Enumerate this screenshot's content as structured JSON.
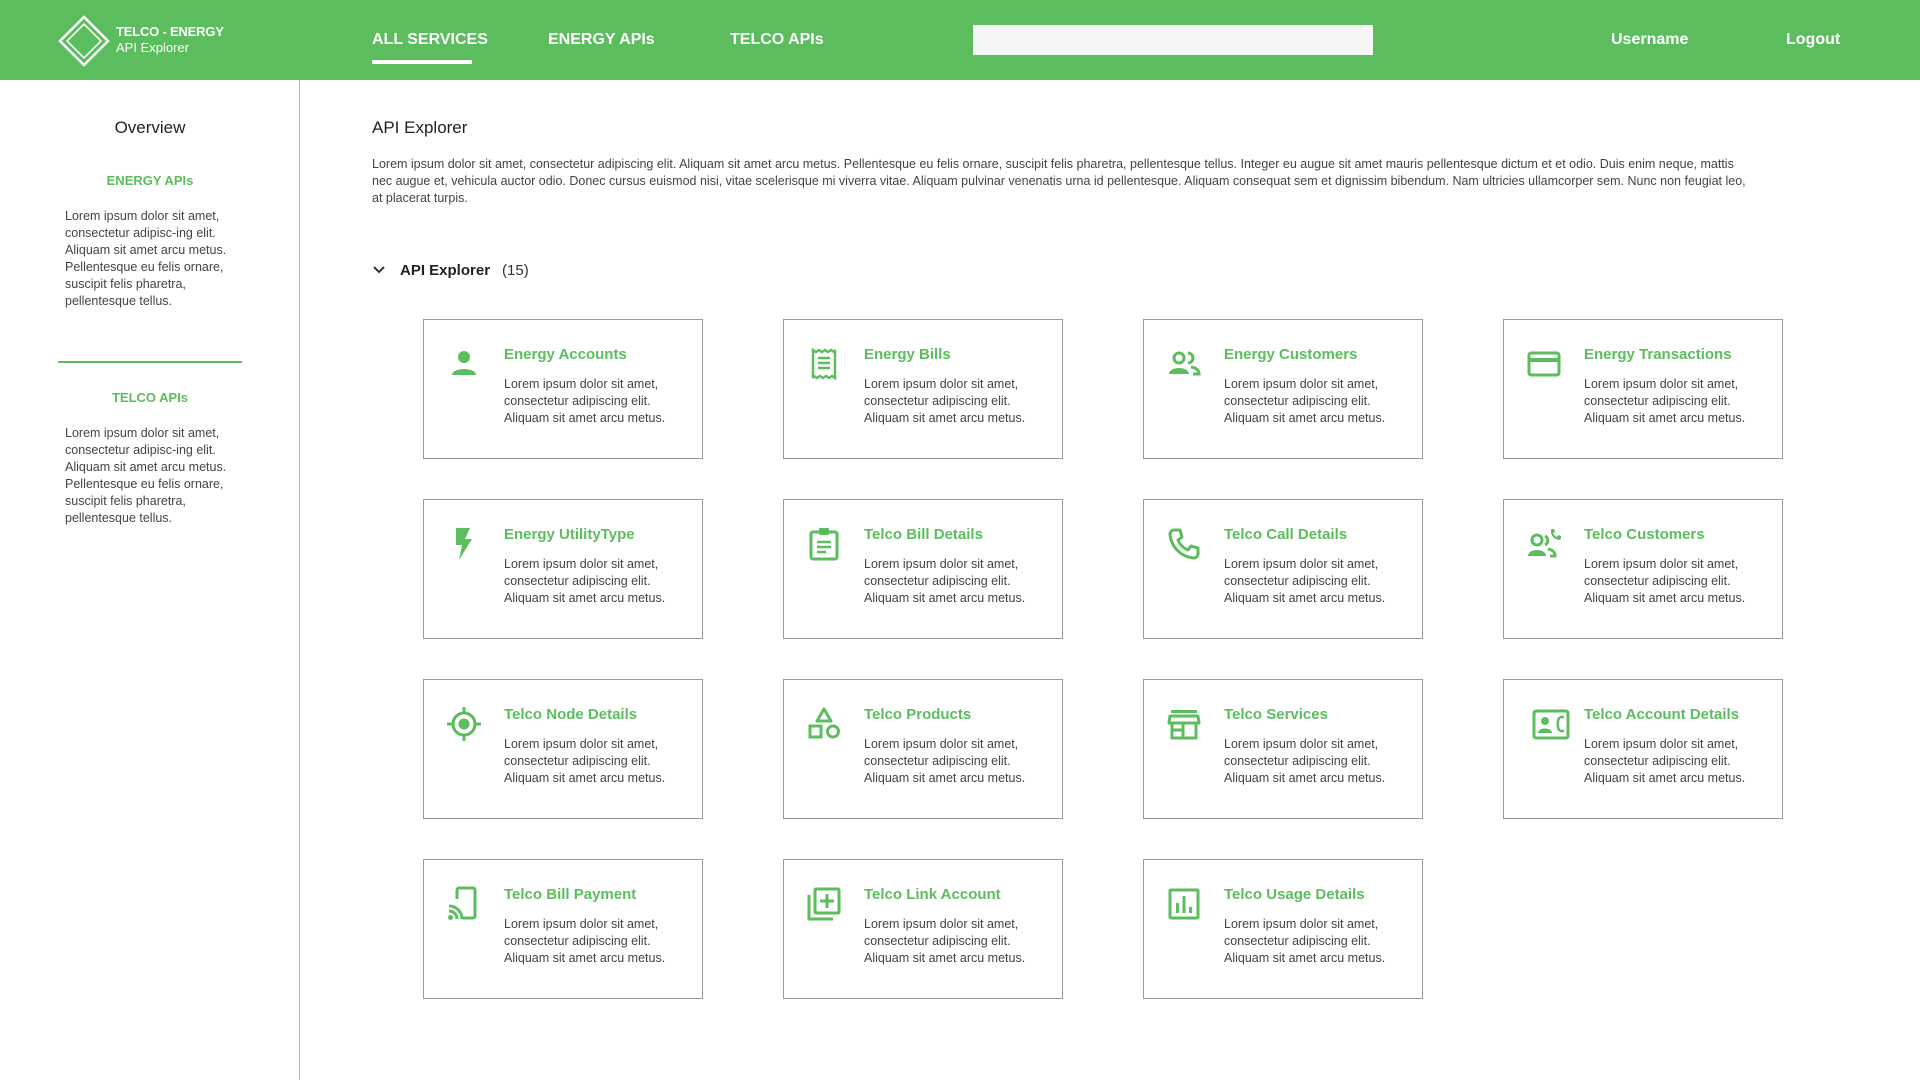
{
  "brand": {
    "line1": "TELCO - ENERGY",
    "line2": "API Explorer",
    "color": "#5cbd5f"
  },
  "nav": {
    "items": [
      {
        "label": "ALL SERVICES",
        "active": true
      },
      {
        "label": "ENERGY APIs",
        "active": false
      },
      {
        "label": "TELCO APIs",
        "active": false
      }
    ],
    "search": {
      "value": "",
      "placeholder": ""
    },
    "username": "Username",
    "logout": "Logout"
  },
  "sidebar": {
    "title": "Overview",
    "sections": [
      {
        "heading": "ENERGY APIs",
        "text": "Lorem ipsum dolor sit amet, consectetur adipisc-ing elit. Aliquam sit amet arcu metus. Pellentesque eu felis ornare, suscipit felis pharetra, pellentesque tellus."
      },
      {
        "heading": "TELCO APIs",
        "text": "Lorem ipsum dolor sit amet, consectetur adipisc-ing elit. Aliquam sit amet arcu metus. Pellentesque eu felis ornare, suscipit felis pharetra, pellentesque tellus."
      }
    ]
  },
  "main": {
    "title": "API Explorer",
    "description": "Lorem ipsum dolor sit amet, consectetur adipiscing elit. Aliquam sit amet arcu metus. Pellentesque eu felis ornare, suscipit felis pharetra, pellentesque tellus. Integer eu augue sit amet mauris pellentesque dictum et et odio. Duis enim neque, mattis nec augue et, vehicula auctor odio. Donec cursus euismod nisi, vitae scelerisque mi viverra vitae. Aliquam pulvinar venenatis urna id pellentesque. Aliquam consequat sem et dignissim bibendum. Nam ultricies ullamcorper sem. Nunc non feugiat leo, at placerat turpis.",
    "section": {
      "title": "API Explorer",
      "count": "(15)",
      "expanded": true
    },
    "cards": [
      {
        "title": "Energy Accounts",
        "icon": "person-icon",
        "description": "Lorem ipsum dolor sit amet, consectetur adipiscing elit. Aliquam sit amet arcu metus."
      },
      {
        "title": "Energy Bills",
        "icon": "receipt-icon",
        "description": "Lorem ipsum dolor sit amet, consectetur adipiscing elit. Aliquam sit amet arcu metus."
      },
      {
        "title": "Energy Customers",
        "icon": "people-icon",
        "description": "Lorem ipsum dolor sit amet, consectetur adipiscing elit. Aliquam sit amet arcu metus."
      },
      {
        "title": "Energy Transactions",
        "icon": "credit-card-icon",
        "description": "Lorem ipsum dolor sit amet, consectetur adipiscing elit. Aliquam sit amet arcu metus."
      },
      {
        "title": "Energy UtilityType",
        "icon": "bolt-icon",
        "description": "Lorem ipsum dolor sit amet, consectetur adipiscing elit. Aliquam sit amet arcu metus."
      },
      {
        "title": "Telco Bill Details",
        "icon": "clipboard-icon",
        "description": "Lorem ipsum dolor sit amet, consectetur adipiscing elit. Aliquam sit amet arcu metus."
      },
      {
        "title": "Telco Call Details",
        "icon": "phone-icon",
        "description": "Lorem ipsum dolor sit amet, consectetur adipiscing elit. Aliquam sit amet arcu metus."
      },
      {
        "title": "Telco Customers",
        "icon": "people-call-icon",
        "description": "Lorem ipsum dolor sit amet, consectetur adipiscing elit. Aliquam sit amet arcu metus."
      },
      {
        "title": "Telco Node Details",
        "icon": "target-icon",
        "description": "Lorem ipsum dolor sit amet, consectetur adipiscing elit. Aliquam sit amet arcu metus."
      },
      {
        "title": "Telco Products",
        "icon": "shapes-icon",
        "description": "Lorem ipsum dolor sit amet, consectetur adipiscing elit. Aliquam sit amet arcu metus."
      },
      {
        "title": "Telco Services",
        "icon": "store-icon",
        "description": "Lorem ipsum dolor sit amet, consectetur adipiscing elit. Aliquam sit amet arcu metus."
      },
      {
        "title": "Telco Account Details",
        "icon": "contact-phone-icon",
        "description": "Lorem ipsum dolor sit amet, consectetur adipiscing elit. Aliquam sit amet arcu metus."
      },
      {
        "title": "Telco Bill Payment",
        "icon": "tap-pay-icon",
        "description": "Lorem ipsum dolor sit amet, consectetur adipiscing elit. Aliquam sit amet arcu metus."
      },
      {
        "title": "Telco Link Account",
        "icon": "library-add-icon",
        "description": "Lorem ipsum dolor sit amet, consectetur adipiscing elit. Aliquam sit amet arcu metus."
      },
      {
        "title": "Telco Usage Details",
        "icon": "bar-chart-icon",
        "description": "Lorem ipsum dolor sit amet, consectetur adipiscing elit. Aliquam sit amet arcu metus."
      }
    ]
  }
}
